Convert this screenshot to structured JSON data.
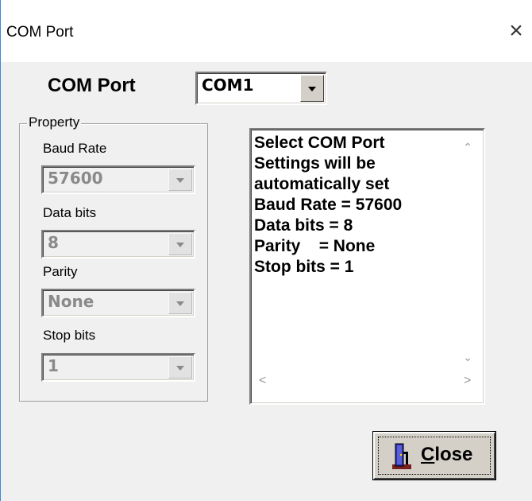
{
  "window": {
    "title": "COM Port",
    "close_glyph": "×"
  },
  "com_port": {
    "label": "COM Port",
    "selected": "COM1"
  },
  "property_group": {
    "legend": "Property",
    "fields": [
      {
        "label": "Baud Rate",
        "value": "57600"
      },
      {
        "label": "Data bits",
        "value": "8"
      },
      {
        "label": "Parity",
        "value": "None"
      },
      {
        "label": "Stop bits",
        "value": "1"
      }
    ]
  },
  "info_text": {
    "lines": "Select COM Port\nSettings will be\nautomatically set\nBaud Rate = 57600\nData bits = 8\nParity    = None\nStop bits = 1"
  },
  "buttons": {
    "close_label_first": "C",
    "close_label_rest": "lose"
  },
  "icons": {
    "close_button_icon": "door-exit-icon"
  }
}
